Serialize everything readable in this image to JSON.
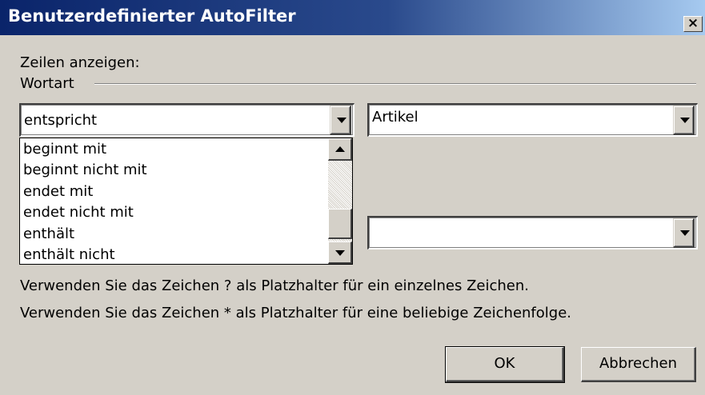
{
  "dialog": {
    "title": "Benutzerdefinierter AutoFilter",
    "close_glyph": "×"
  },
  "filter": {
    "show_rows_label": "Zeilen anzeigen:",
    "group_label": "Wortart",
    "condition1": {
      "operator": "entspricht",
      "value": "Artikel"
    },
    "condition2": {
      "operator": "",
      "value": ""
    }
  },
  "operator_list": {
    "items": [
      "beginnt mit",
      "beginnt nicht mit",
      "endet mit",
      "endet nicht mit",
      "enthält",
      "enthält nicht"
    ]
  },
  "hints": {
    "line1": "Verwenden Sie das Zeichen ? als Platzhalter für ein einzelnes Zeichen.",
    "line2": "Verwenden Sie das Zeichen * als Platzhalter für eine beliebige Zeichenfolge."
  },
  "buttons": {
    "ok": "OK",
    "cancel": "Abbrechen"
  },
  "icons": {
    "close": "close-icon",
    "dropdown": "chevron-down-icon",
    "scroll_up": "arrow-up-icon",
    "scroll_down": "arrow-down-icon"
  }
}
